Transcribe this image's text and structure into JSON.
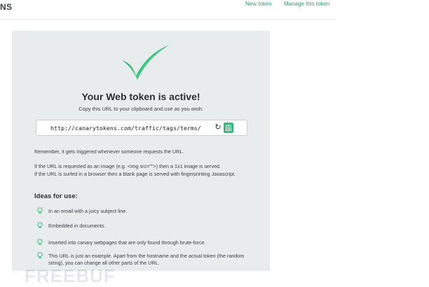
{
  "header": {
    "brand_fragment": "NS",
    "nav": {
      "new_token": "New token",
      "manage_token": "Manage this token"
    }
  },
  "card": {
    "title": "Your Web token is active!",
    "subtitle": "Copy this URL to your clipboard and use as you wish:",
    "url": "http://canarytokens.com/traffic/tags/terms/",
    "paragraphs": [
      "Remember, it gets triggered whenever someone requests the URL.",
      "If the URL is requested as an image (e.g. <img src=\"\">) then a 1x1 image is served.",
      "If the URL is surfed in a browser then a blank page is served with fingerprinting Javascript."
    ],
    "ideas_title": "Ideas for use:",
    "ideas": [
      "In an email with a juicy subject line.",
      "Embedded in documents.",
      "Inserted into canary webpages that are only found through brute-force.",
      "This URL is just an example. Apart from the hostname and the actual token (the random string), you can change all other parts of the URL."
    ],
    "icons": {
      "refresh": "refresh-icon",
      "copy": "clipboard-icon",
      "bulb": "lightbulb-icon",
      "check": "checkmark-icon"
    },
    "accent_color": "#2fbf77"
  },
  "watermark": "FREEBUF"
}
